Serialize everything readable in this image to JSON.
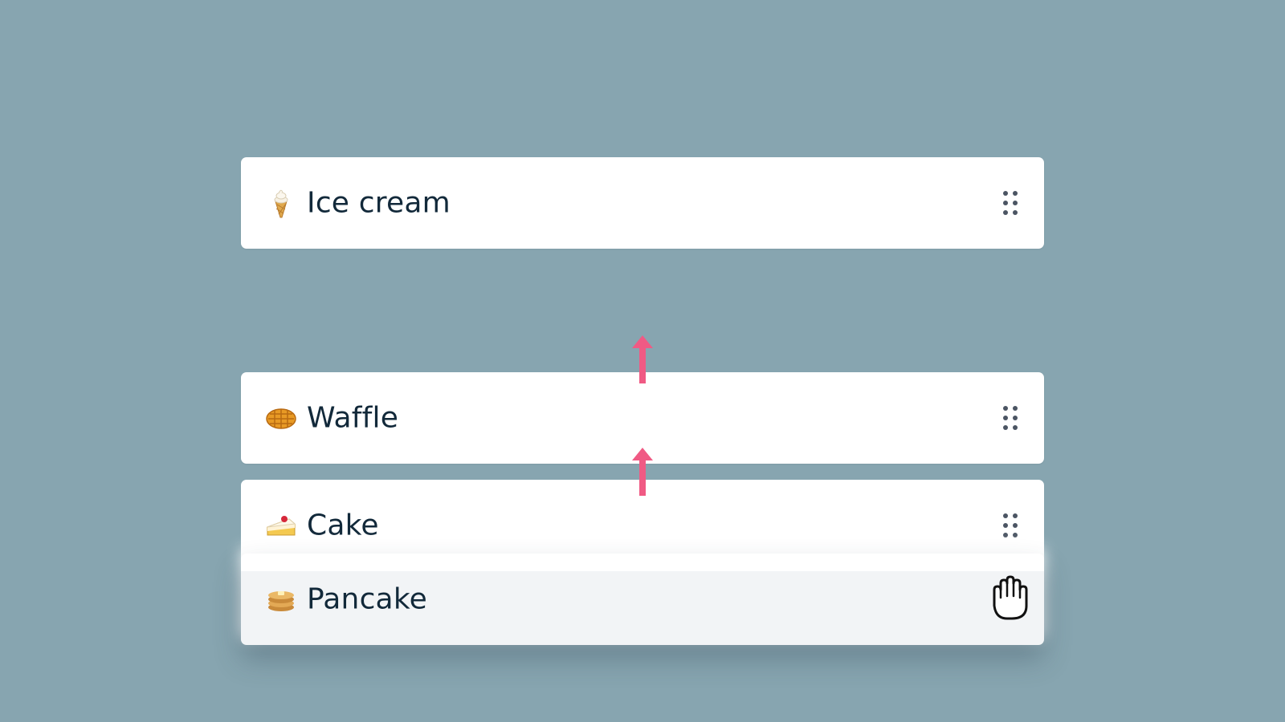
{
  "list": {
    "items": [
      {
        "label": "Ice cream",
        "icon": "ice-cream-icon"
      },
      {
        "label": "Waffle",
        "icon": "waffle-icon"
      },
      {
        "label": "Cake",
        "icon": "cake-icon"
      },
      {
        "label": "Pancake",
        "icon": "pancake-icon",
        "dragging": true
      }
    ]
  },
  "colors": {
    "background": "#87a5b0",
    "card": "#ffffff",
    "dragged_card": "#f2f4f6",
    "text": "#12293a",
    "arrow": "#f05a84"
  }
}
